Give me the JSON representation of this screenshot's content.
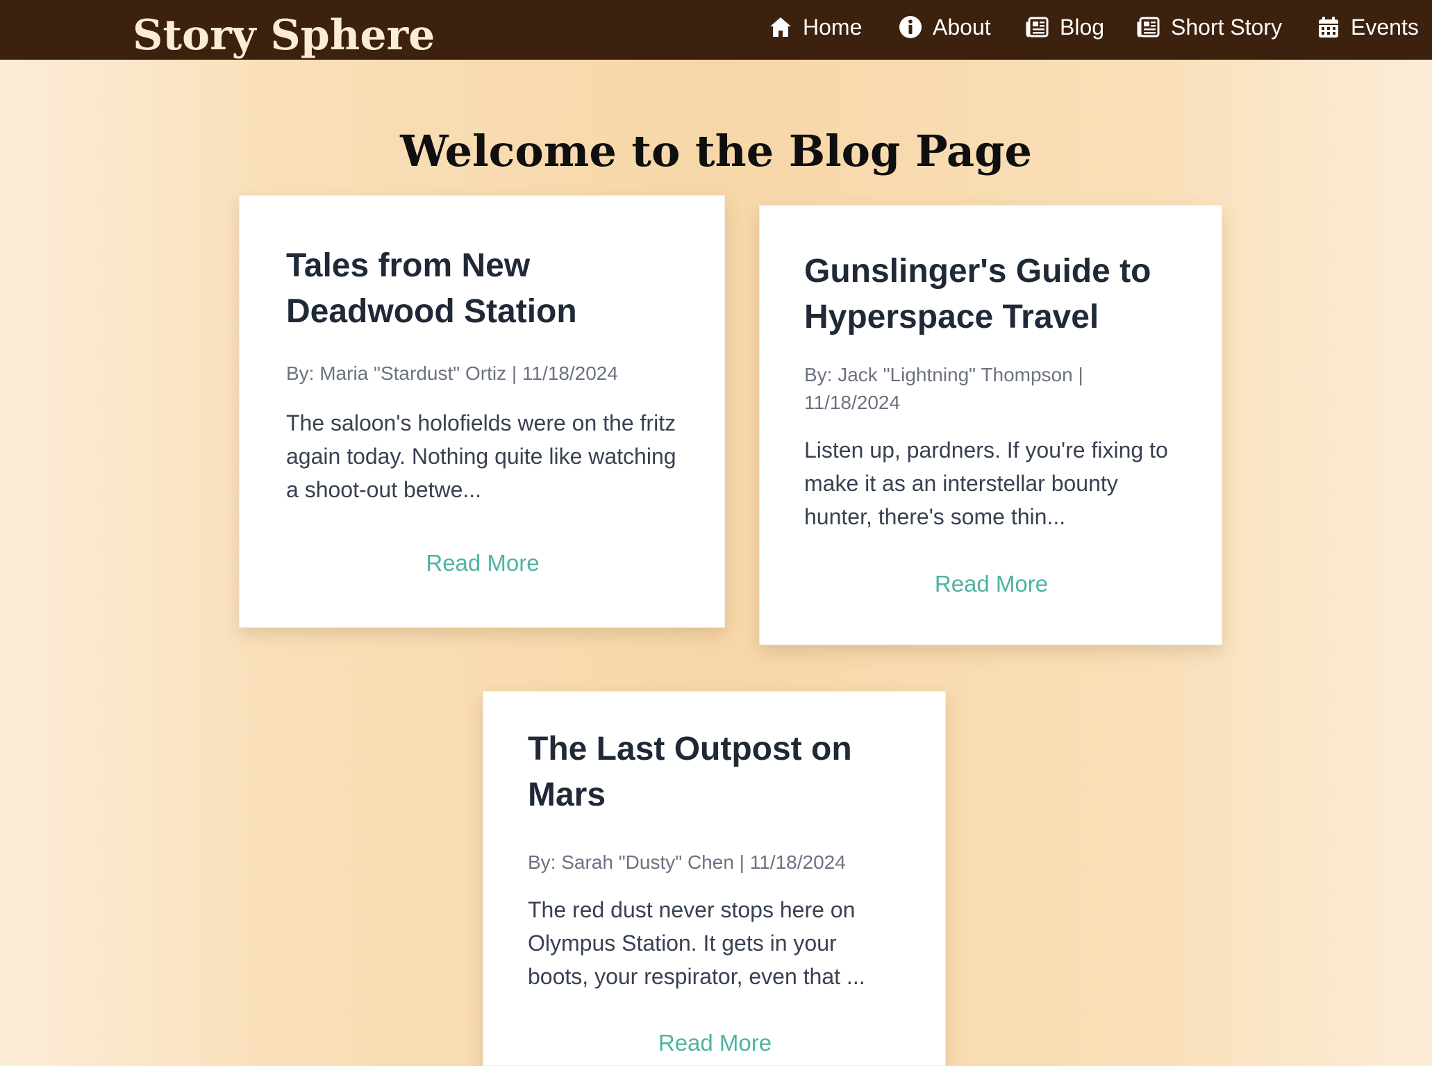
{
  "header": {
    "brand": "Story Sphere",
    "nav": [
      {
        "label": "Home",
        "icon": "home-icon"
      },
      {
        "label": "About",
        "icon": "info-icon"
      },
      {
        "label": "Blog",
        "icon": "newspaper-icon"
      },
      {
        "label": "Short Story",
        "icon": "newspaper-icon"
      },
      {
        "label": "Events",
        "icon": "calendar-icon"
      }
    ]
  },
  "main": {
    "heading": "Welcome to the Blog Page",
    "posts": [
      {
        "title": "Tales from New Deadwood Station",
        "meta": "By: Maria \"Stardust\" Ortiz | 11/18/2024",
        "excerpt": "The saloon's holofields were on the fritz again today. Nothing quite like watching a shoot-out betwe...",
        "link": "Read More"
      },
      {
        "title": "Gunslinger's Guide to Hyperspace Travel",
        "meta": "By: Jack \"Lightning\" Thompson | 11/18/2024",
        "excerpt": "Listen up, pardners. If you're fixing to make it as an interstellar bounty hunter, there's some thin...",
        "link": "Read More"
      },
      {
        "title": "The Last Outpost on Mars",
        "meta": "By: Sarah \"Dusty\" Chen | 11/18/2024",
        "excerpt": "The red dust never stops here on Olympus Station. It gets in your boots, your respirator, even that ...",
        "link": "Read More"
      }
    ]
  },
  "colors": {
    "navbar": "#3c210e",
    "brand": "#fcecd2",
    "link": "#4eb3a3",
    "title": "#1f2937",
    "meta": "#6b7280"
  }
}
